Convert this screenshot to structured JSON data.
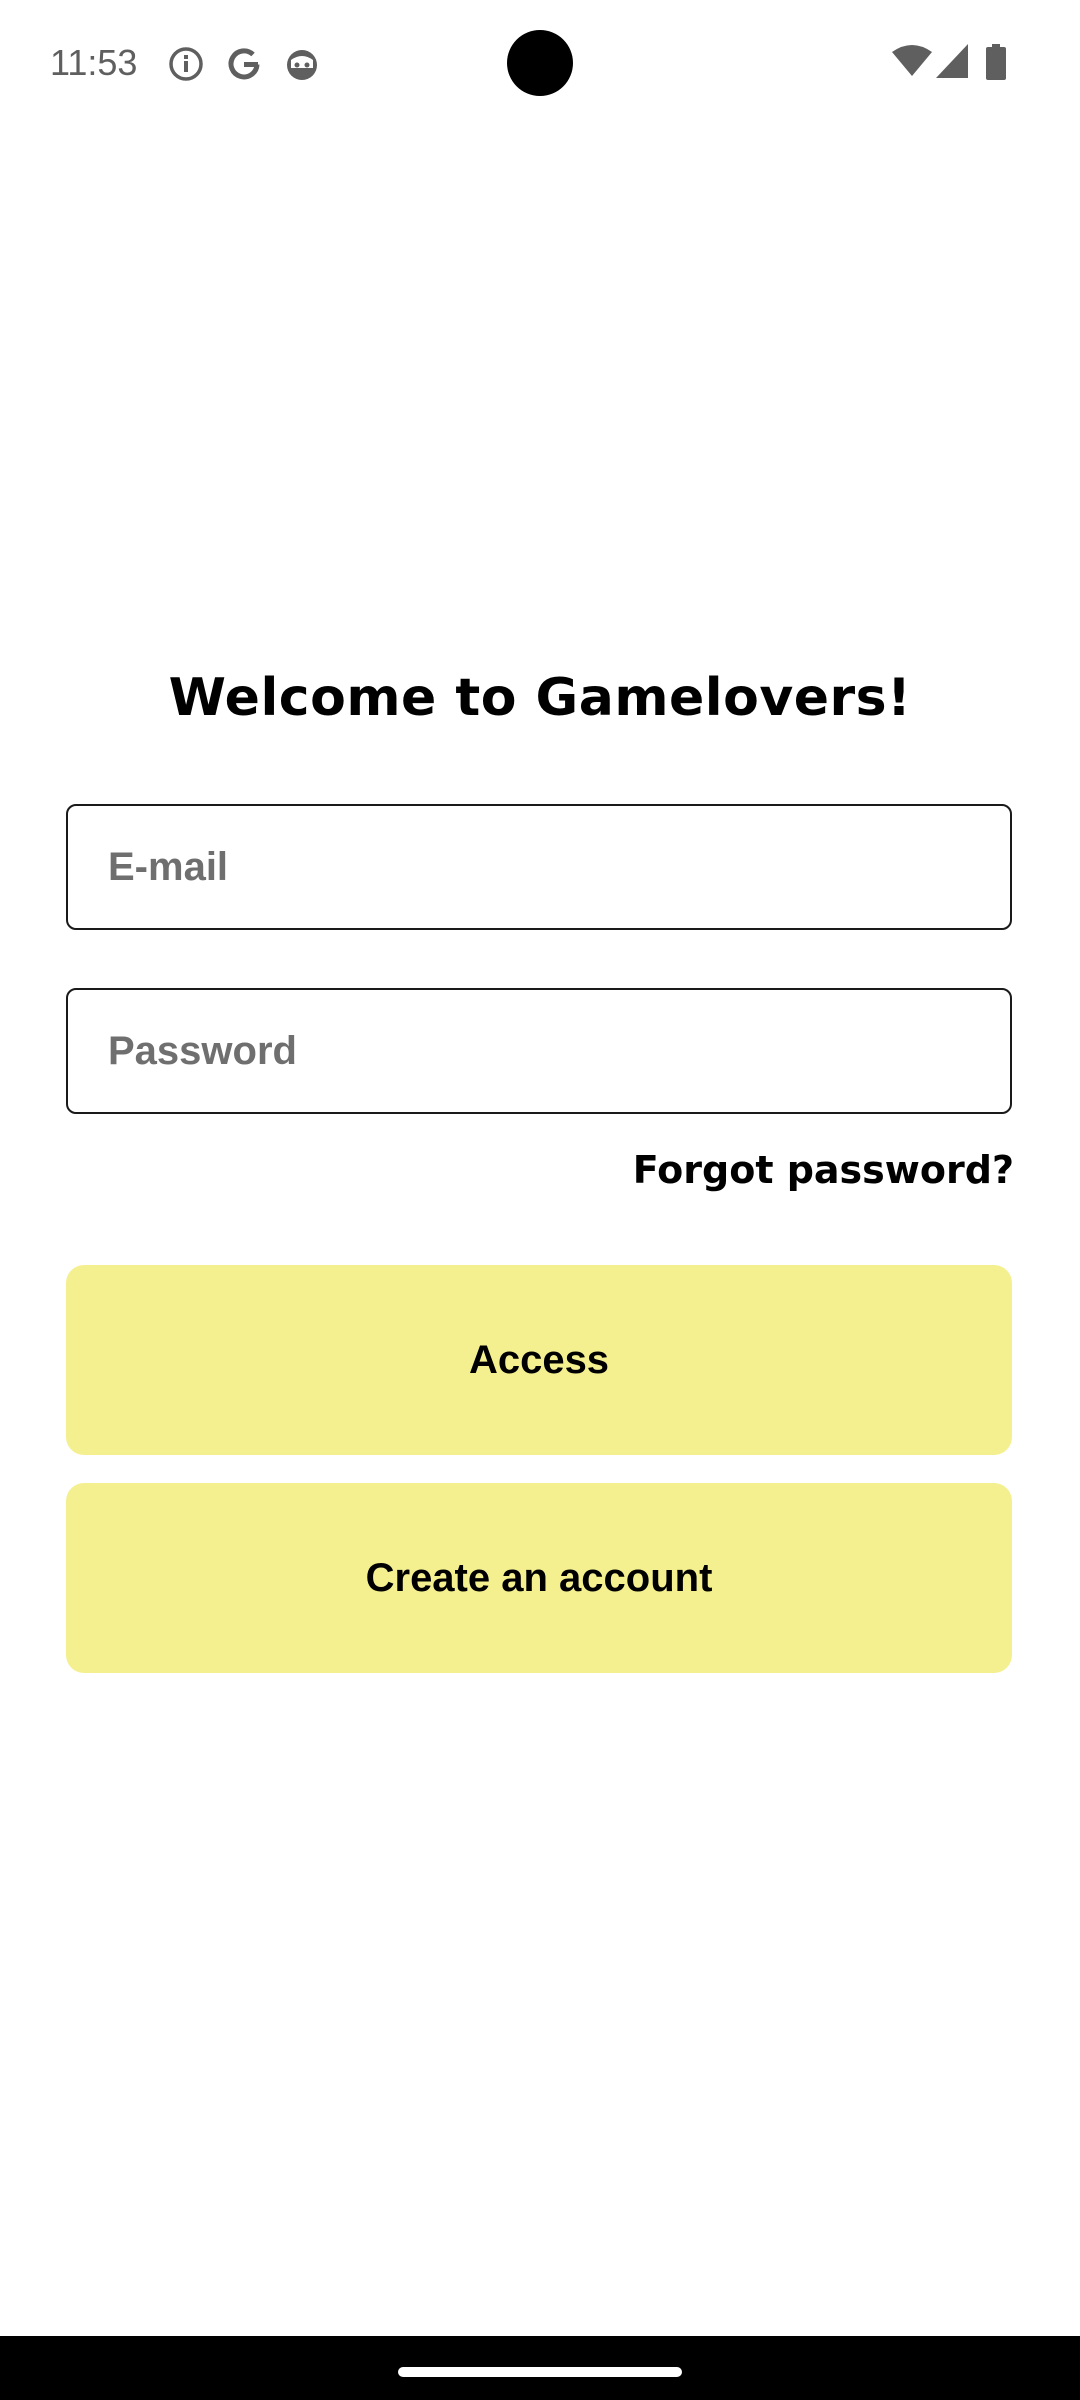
{
  "status_bar": {
    "time": "11:53",
    "left_icons": [
      "info-icon",
      "google-icon",
      "cat-face-icon"
    ],
    "right_icons": [
      "wifi-icon",
      "cellular-signal-icon",
      "battery-icon"
    ]
  },
  "login": {
    "title": "Welcome to Gamelovers!",
    "email_placeholder": "E-mail",
    "password_placeholder": "Password",
    "forgot_password": "Forgot password?",
    "access_label": "Access",
    "create_account_label": "Create an account"
  },
  "colors": {
    "button_background": "#f4f090",
    "text": "#000000",
    "placeholder": "#6f6f6f"
  }
}
